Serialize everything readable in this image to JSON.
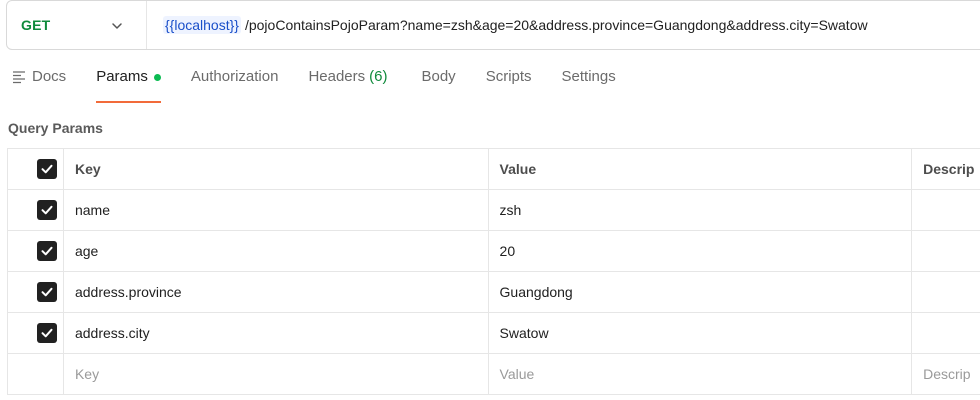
{
  "request": {
    "method": "GET",
    "url_variable": "{{localhost}}",
    "url_path": "/pojoContainsPojoParam?name=zsh&age=20&address.province=Guangdong&address.city=Swatow"
  },
  "tabs": {
    "docs": "Docs",
    "params": "Params",
    "authorization": "Authorization",
    "headers": "Headers",
    "headers_count": "(6)",
    "body": "Body",
    "scripts": "Scripts",
    "settings": "Settings"
  },
  "query_params": {
    "title": "Query Params",
    "columns": {
      "key": "Key",
      "value": "Value",
      "description": "Descrip"
    },
    "rows": [
      {
        "key": "name",
        "value": "zsh"
      },
      {
        "key": "age",
        "value": "20"
      },
      {
        "key": "address.province",
        "value": "Guangdong"
      },
      {
        "key": "address.city",
        "value": "Swatow"
      }
    ],
    "placeholders": {
      "key": "Key",
      "value": "Value",
      "description": "Descrip"
    }
  },
  "colors": {
    "method": "#0f8a3b",
    "active_tab_underline": "#f26b3a",
    "params_dot": "#0cbb52",
    "variable": "#1a4fc9"
  },
  "icons": {
    "method_dropdown": "chevron-down-icon",
    "docs": "docs-lines-icon",
    "checkbox": "check-icon"
  }
}
